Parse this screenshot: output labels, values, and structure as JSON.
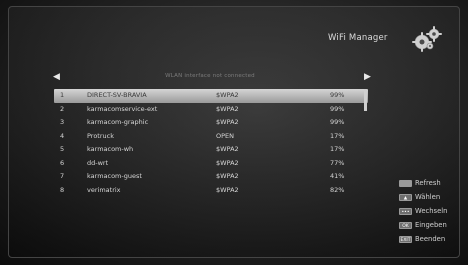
{
  "header": {
    "title": "WiFi Manager"
  },
  "status_line": "WLAN interface not connected",
  "networks": [
    {
      "idx": "1",
      "ssid": "DIRECT-SV-BRAVIA",
      "enc": "$WPA2",
      "signal": "99%"
    },
    {
      "idx": "2",
      "ssid": "karmacomservice-ext",
      "enc": "$WPA2",
      "signal": "99%"
    },
    {
      "idx": "3",
      "ssid": "karmacom-graphic",
      "enc": "$WPA2",
      "signal": "99%"
    },
    {
      "idx": "4",
      "ssid": "Protruck",
      "enc": "OPEN",
      "signal": "17%"
    },
    {
      "idx": "5",
      "ssid": "karmacom-wh",
      "enc": "$WPA2",
      "signal": "17%"
    },
    {
      "idx": "6",
      "ssid": "dd-wrt",
      "enc": "$WPA2",
      "signal": "77%"
    },
    {
      "idx": "7",
      "ssid": "karmacom-guest",
      "enc": "$WPA2",
      "signal": "41%"
    },
    {
      "idx": "8",
      "ssid": "verimatrix",
      "enc": "$WPA2",
      "signal": "82%"
    }
  ],
  "legend": {
    "refresh": "Refresh",
    "select": "Wählen",
    "switch": "Wechseln",
    "enter": "Eingeben",
    "exit": "Beenden",
    "key_ok": "OK",
    "key_exit": "EXIT",
    "key_dots": "•••"
  },
  "colors": {
    "selected_row": "#c2c2c2",
    "text": "#d6d6d6",
    "background": "#262626"
  }
}
